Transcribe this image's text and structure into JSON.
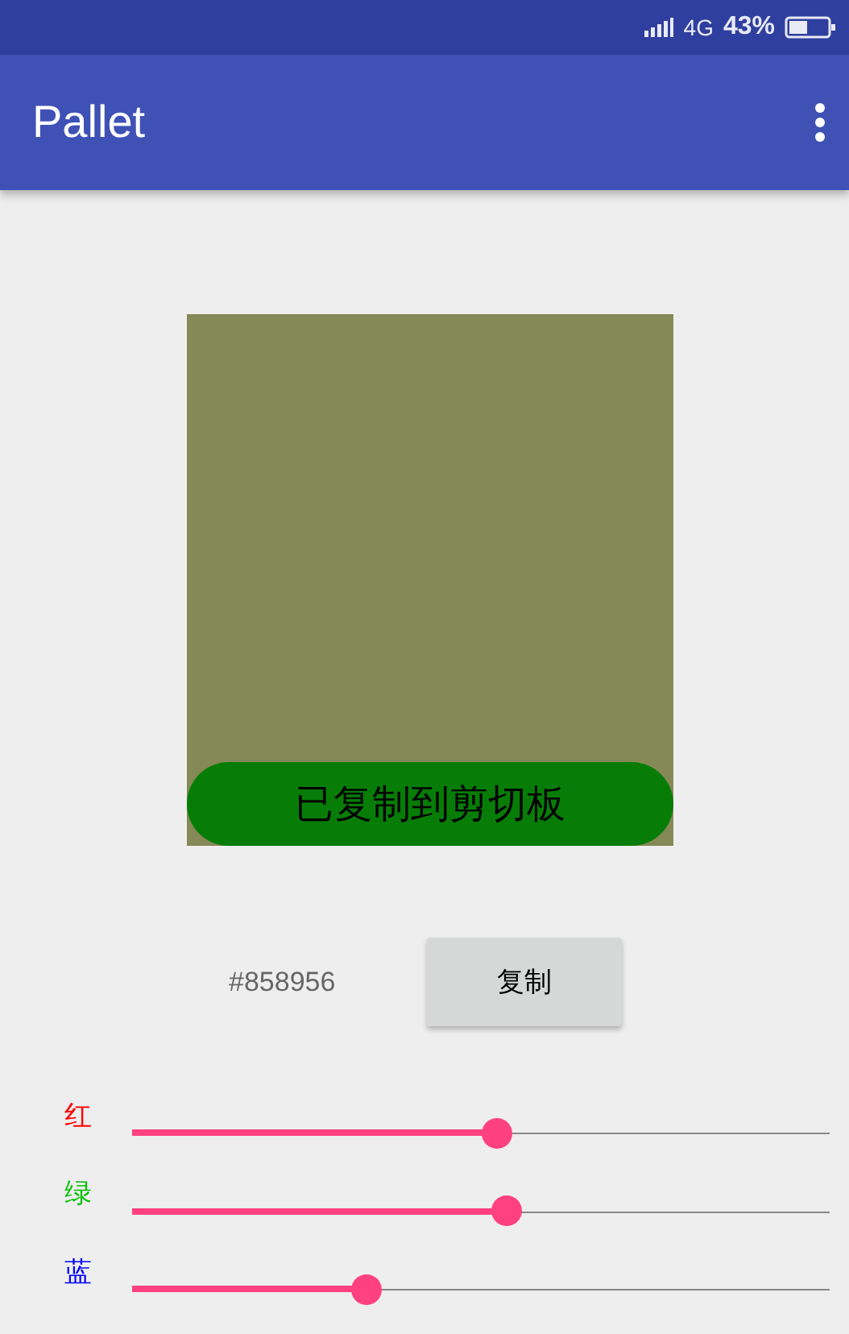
{
  "status_bar": {
    "network": "4G",
    "battery": "43%"
  },
  "app_bar": {
    "title": "Pallet"
  },
  "toast": {
    "text": "已复制到剪切板"
  },
  "hex": {
    "value": "#858956"
  },
  "copy_button": {
    "label": "复制"
  },
  "channels": [
    {
      "label": "红",
      "color": "#ff0000",
      "level": 0.522
    },
    {
      "label": "绿",
      "color": "#00c000",
      "level": 0.537
    },
    {
      "label": "蓝",
      "color": "#0000ff",
      "level": 0.337
    }
  ]
}
